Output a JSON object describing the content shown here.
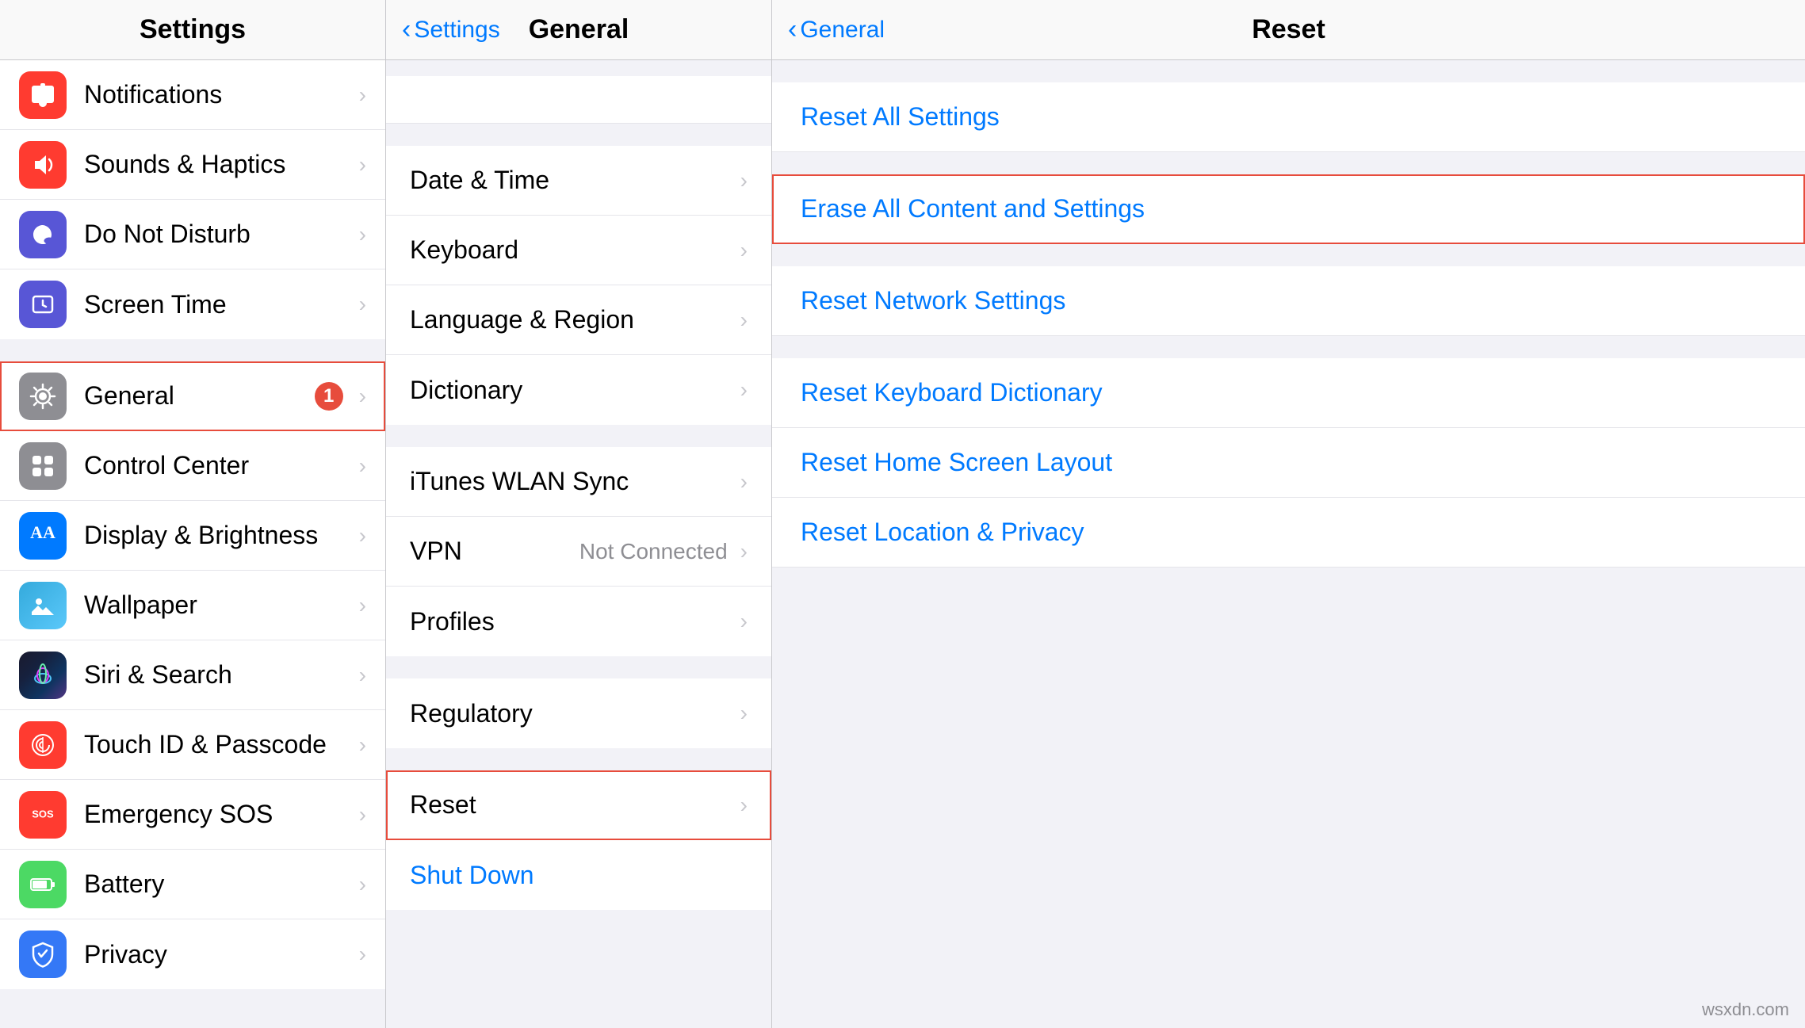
{
  "left_column": {
    "header": {
      "title": "Settings"
    },
    "groups": [
      {
        "items": [
          {
            "id": "notifications",
            "label": "Notifications",
            "icon_bg": "#ff3b30",
            "icon_type": "notifications"
          },
          {
            "id": "sounds",
            "label": "Sounds & Haptics",
            "icon_bg": "#ff3b30",
            "icon_type": "sounds"
          },
          {
            "id": "do-not-disturb",
            "label": "Do Not Disturb",
            "icon_bg": "#5856d6",
            "icon_type": "moon"
          },
          {
            "id": "screen-time",
            "label": "Screen Time",
            "icon_bg": "#5856d6",
            "icon_type": "screentime"
          }
        ]
      },
      {
        "items": [
          {
            "id": "general",
            "label": "General",
            "icon_bg": "#8e8e93",
            "icon_type": "gear",
            "badge": "1",
            "highlighted": true
          },
          {
            "id": "control-center",
            "label": "Control Center",
            "icon_bg": "#8e8e93",
            "icon_type": "control"
          },
          {
            "id": "display-brightness",
            "label": "Display & Brightness",
            "icon_bg": "#007aff",
            "icon_type": "display"
          },
          {
            "id": "wallpaper",
            "label": "Wallpaper",
            "icon_bg": "#34aadc",
            "icon_type": "wallpaper"
          },
          {
            "id": "siri-search",
            "label": "Siri & Search",
            "icon_bg": "#000",
            "icon_type": "siri"
          },
          {
            "id": "touch-id",
            "label": "Touch ID & Passcode",
            "icon_bg": "#ff3b30",
            "icon_type": "touchid"
          },
          {
            "id": "emergency-sos",
            "label": "Emergency SOS",
            "icon_bg": "#ff3b30",
            "icon_type": "sos"
          },
          {
            "id": "battery",
            "label": "Battery",
            "icon_bg": "#4cd964",
            "icon_type": "battery"
          },
          {
            "id": "privacy",
            "label": "Privacy",
            "icon_bg": "#3478f6",
            "icon_type": "privacy"
          }
        ]
      }
    ]
  },
  "middle_column": {
    "header": {
      "back_label": "Settings",
      "title": "General"
    },
    "groups": [
      {
        "items": [
          {
            "id": "date-time",
            "label": "Date & Time",
            "value": ""
          },
          {
            "id": "keyboard",
            "label": "Keyboard",
            "value": ""
          },
          {
            "id": "language-region",
            "label": "Language & Region",
            "value": ""
          },
          {
            "id": "dictionary",
            "label": "Dictionary",
            "value": ""
          }
        ]
      },
      {
        "items": [
          {
            "id": "itunes-wlan",
            "label": "iTunes WLAN Sync",
            "value": ""
          },
          {
            "id": "vpn",
            "label": "VPN",
            "value": "Not Connected"
          },
          {
            "id": "profiles",
            "label": "Profiles",
            "value": ""
          }
        ]
      },
      {
        "items": [
          {
            "id": "regulatory",
            "label": "Regulatory",
            "value": ""
          }
        ]
      },
      {
        "items": [
          {
            "id": "reset",
            "label": "Reset",
            "value": "",
            "highlighted": true
          },
          {
            "id": "shut-down",
            "label": "Shut Down",
            "value": "",
            "is_link": true
          }
        ]
      }
    ]
  },
  "right_column": {
    "header": {
      "back_label": "General",
      "title": "Reset"
    },
    "groups": [
      {
        "items": [
          {
            "id": "reset-all",
            "label": "Reset All Settings"
          }
        ]
      },
      {
        "items": [
          {
            "id": "erase-all",
            "label": "Erase All Content and Settings",
            "highlighted": true
          }
        ]
      },
      {
        "items": [
          {
            "id": "reset-network",
            "label": "Reset Network Settings"
          }
        ]
      },
      {
        "items": [
          {
            "id": "reset-keyboard",
            "label": "Reset Keyboard Dictionary"
          },
          {
            "id": "reset-home-screen",
            "label": "Reset Home Screen Layout"
          },
          {
            "id": "reset-location",
            "label": "Reset Location & Privacy"
          }
        ]
      }
    ]
  },
  "watermark": "wsxdn.com"
}
